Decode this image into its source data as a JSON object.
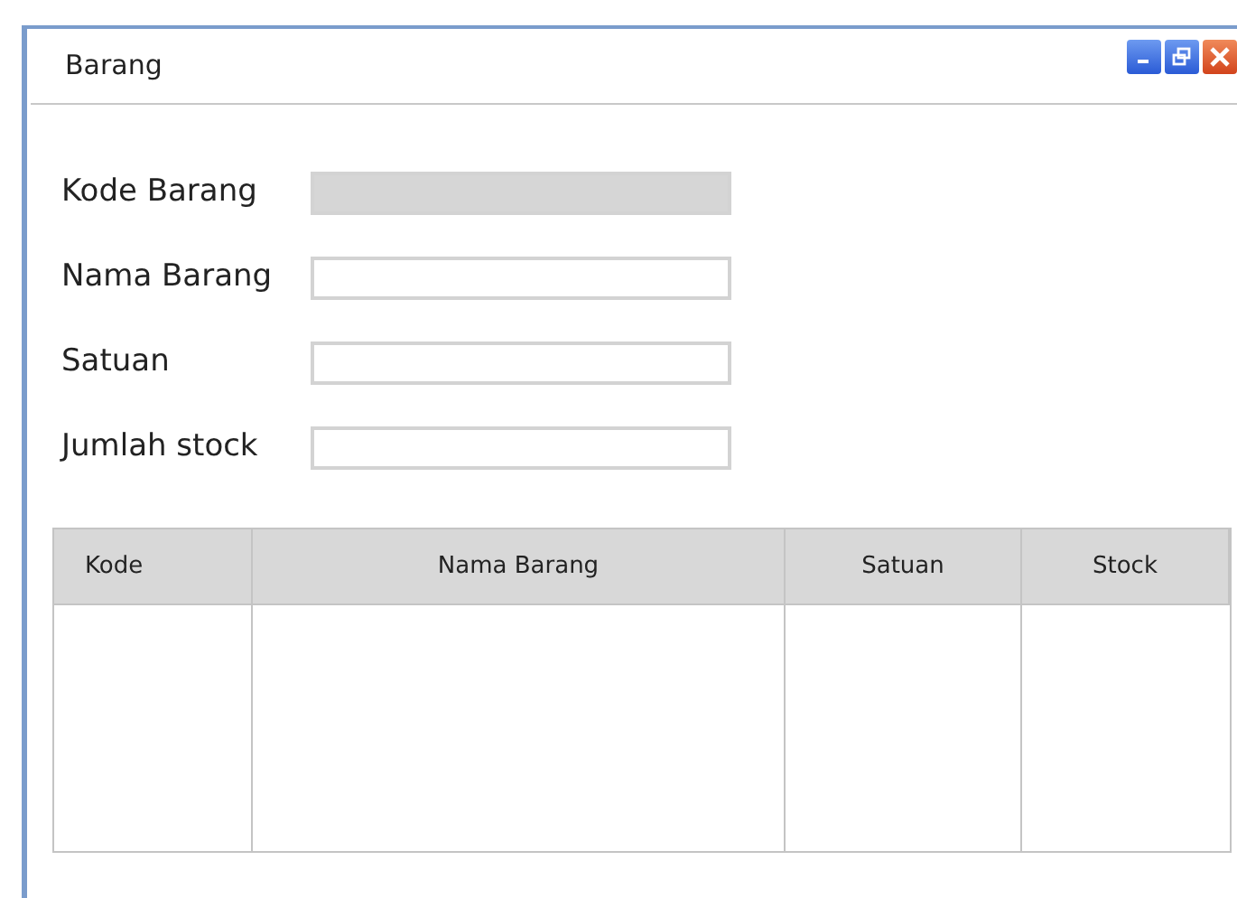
{
  "window": {
    "title": "Barang"
  },
  "fields": [
    {
      "label": "Kode Barang",
      "disabled": true
    },
    {
      "label": "Nama Barang",
      "disabled": false
    },
    {
      "label": "Satuan",
      "disabled": false
    },
    {
      "label": "Jumlah stock",
      "disabled": false
    }
  ],
  "table": {
    "columns": [
      "Kode",
      "Nama Barang",
      "Satuan",
      "Stock"
    ]
  }
}
